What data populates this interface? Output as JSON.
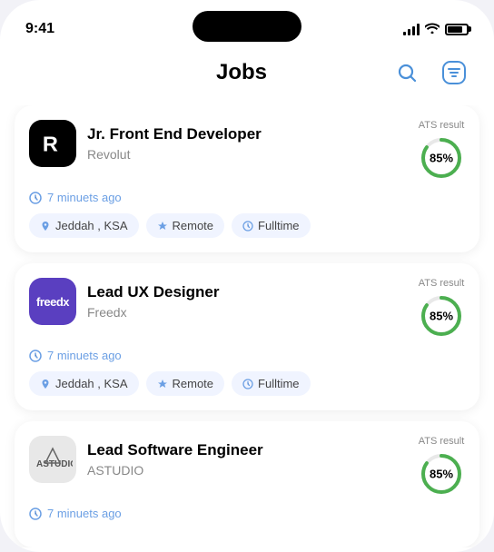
{
  "statusBar": {
    "time": "9:41",
    "battery": 80
  },
  "header": {
    "title": "Jobs",
    "searchLabel": "search",
    "filterLabel": "filter"
  },
  "jobs": [
    {
      "id": 1,
      "title": "Jr. Front End Developer",
      "company": "Revolut",
      "logoType": "revolut",
      "atsLabel": "ATS result",
      "atsPercent": "85%",
      "atsValue": 85,
      "timePosted": "7 minuets ago",
      "tags": [
        {
          "icon": "📍",
          "label": "Jeddah , KSA",
          "type": "location"
        },
        {
          "icon": "🎓",
          "label": "Remote",
          "type": "remote"
        },
        {
          "icon": "🕐",
          "label": "Fulltime",
          "type": "time"
        }
      ]
    },
    {
      "id": 2,
      "title": "Lead UX Designer",
      "company": "Freedx",
      "logoType": "freedx",
      "atsLabel": "ATS result",
      "atsPercent": "85%",
      "atsValue": 85,
      "timePosted": "7 minuets ago",
      "tags": [
        {
          "icon": "📍",
          "label": "Jeddah , KSA",
          "type": "location"
        },
        {
          "icon": "🎓",
          "label": "Remote",
          "type": "remote"
        },
        {
          "icon": "🕐",
          "label": "Fulltime",
          "type": "time"
        }
      ]
    },
    {
      "id": 3,
      "title": "Lead Software Engineer",
      "company": "ASTUDIO",
      "logoType": "astudio",
      "atsLabel": "ATS result",
      "atsPercent": "85%",
      "atsValue": 85,
      "timePosted": "7 minuets ago",
      "tags": []
    }
  ],
  "colors": {
    "accent": "#6B9FE4",
    "atsGreen": "#4CAF50",
    "tagBg": "#f0f4ff",
    "revolut": "#000000",
    "freedx": "#5a3fc0"
  }
}
